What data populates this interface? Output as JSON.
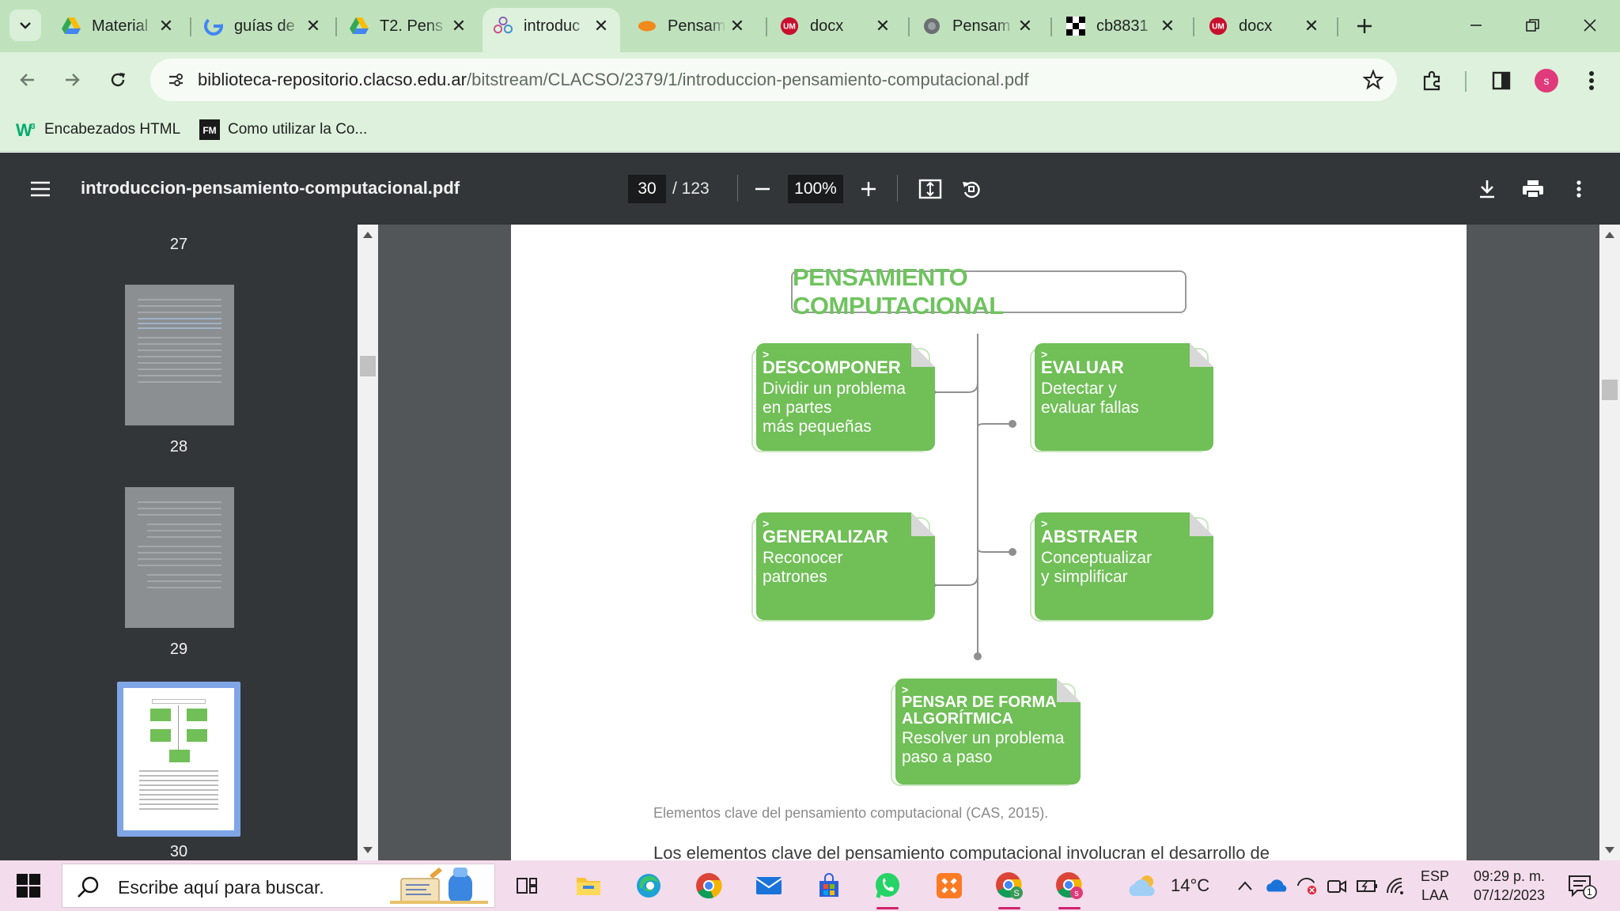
{
  "browser": {
    "tabs": [
      {
        "title": "Material",
        "icon": "google-drive-icon"
      },
      {
        "title": "guías de",
        "icon": "google-icon"
      },
      {
        "title": "T2. Pens",
        "icon": "google-drive-icon"
      },
      {
        "title": "introduc",
        "icon": "clacso-icon",
        "active": true
      },
      {
        "title": "Pensam",
        "icon": "orange-blob-icon"
      },
      {
        "title": "docx",
        "icon": "um-icon"
      },
      {
        "title": "Pensam",
        "icon": "globe-icon"
      },
      {
        "title": "cb8831",
        "icon": "checker-icon"
      },
      {
        "title": "docx",
        "icon": "um-icon"
      }
    ],
    "url_host": "biblioteca-repositorio.clacso.edu.ar",
    "url_path": "/bitstream/CLACSO/2379/1/introduccion-pensamiento-computacional.pdf",
    "profile_initial": "s",
    "bookmarks": [
      {
        "label": "Encabezados HTML",
        "icon": "w3schools-icon"
      },
      {
        "label": "Como utilizar la Co...",
        "icon": "fm-icon"
      }
    ]
  },
  "pdf": {
    "filename": "introduccion-pensamiento-computacional.pdf",
    "current_page": "30",
    "total_pages": "/ 123",
    "zoom": "100%",
    "thumbnails": [
      {
        "page": "27",
        "visible_label_only": true
      },
      {
        "page": "28"
      },
      {
        "page": "29"
      },
      {
        "page": "30",
        "selected": true
      }
    ]
  },
  "document": {
    "diagram_title": "PENSAMIENTO COMPUTACIONAL",
    "cards": [
      {
        "id": "descomponer",
        "title": "DESCOMPONER",
        "lines": [
          "Dividir un problema",
          "en partes",
          "más pequeñas"
        ]
      },
      {
        "id": "evaluar",
        "title": "EVALUAR",
        "lines": [
          "Detectar y",
          "evaluar fallas"
        ]
      },
      {
        "id": "generalizar",
        "title": "GENERALIZAR",
        "lines": [
          "Reconocer",
          "patrones"
        ]
      },
      {
        "id": "abstraer",
        "title": "ABSTRAER",
        "lines": [
          "Conceptualizar",
          "y simplificar"
        ]
      },
      {
        "id": "algoritmica",
        "title": "PENSAR DE FORMA ALGORÍTMICA",
        "title_lines": [
          "PENSAR DE FORMA",
          "ALGORÍTMICA"
        ],
        "lines": [
          "Resolver un problema",
          "paso a paso"
        ]
      }
    ],
    "chevron": ">",
    "caption": "Elementos clave del pensamiento computacional (CAS, 2015).",
    "body_text": "Los elementos clave del pensamiento computacional involucran el desarrollo de"
  },
  "colors": {
    "card_green": "#70bf57",
    "title_green": "#6fc35f",
    "tabbar_bg": "#bfe2bd",
    "toolbar_bg": "#ddf1dc",
    "pdf_bar_bg": "#323639",
    "taskbar_bg": "#f3dcec"
  },
  "taskbar": {
    "search_placeholder": "Escribe aquí para buscar.",
    "temperature": "14°C",
    "lang_1": "ESP",
    "lang_2": "LAA",
    "time": "09:29 p. m.",
    "date": "07/12/2023",
    "notification_count": "1",
    "apps": [
      "task-view-icon",
      "file-explorer-icon",
      "edge-icon",
      "chrome-icon",
      "mail-icon",
      "store-icon",
      "whatsapp-icon",
      "xampp-icon",
      "chrome-profile-icon",
      "chrome-profile-2-icon"
    ]
  }
}
